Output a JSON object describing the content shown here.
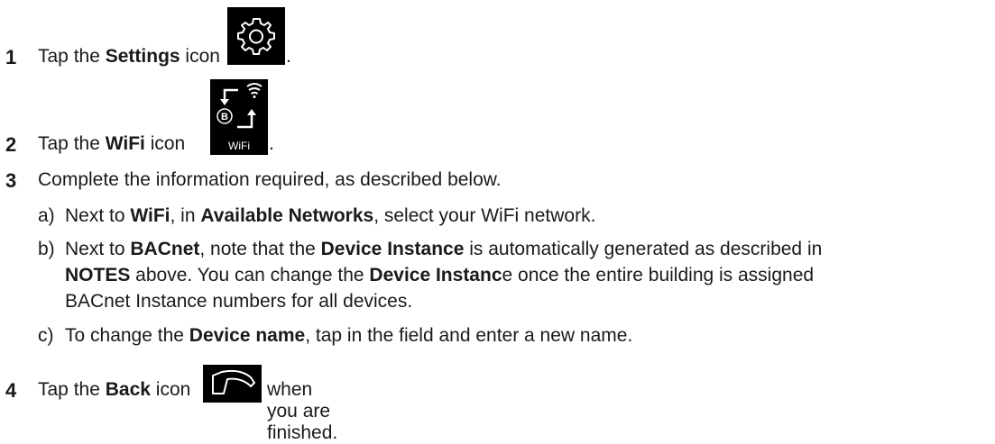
{
  "steps": [
    {
      "number": "1",
      "pre": "Tap the ",
      "bold": "Settings",
      "post": " icon",
      "trail": ".",
      "icon": "gear-icon"
    },
    {
      "number": "2",
      "pre": "Tap the ",
      "bold": "WiFi",
      "post": " icon",
      "trail": ".",
      "icon": "wifi-bacnet-icon",
      "icon_label": "WiFi"
    },
    {
      "number": "3",
      "text": "Complete the information required, as described below."
    },
    {
      "number": "4",
      "pre": "Tap the ",
      "bold": "Back",
      "post": " icon",
      "trail": " when you are finished.",
      "icon": "back-icon"
    }
  ],
  "substeps": {
    "a": {
      "letter": "a)",
      "t1": "Next to ",
      "b1": "WiFi",
      "t2": ", in ",
      "b2": "Available Networks",
      "t3": ", select your WiFi network."
    },
    "b": {
      "letter": "b)",
      "l1_t1": "Next to ",
      "l1_b1": "BACnet",
      "l1_t2": ", note that the ",
      "l1_b2": "Device Instance",
      "l1_t3": " is automatically generated as described in",
      "l2_b1": "NOTES",
      "l2_t1": " above. You can change the ",
      "l2_b2": "Device Instanc",
      "l2_t2": "e once the entire building is assigned",
      "l3": "BACnet Instance numbers for all devices."
    },
    "c": {
      "letter": "c)",
      "t1": "To change the ",
      "b1": "Device name",
      "t2": ", tap in the field and enter a new name."
    }
  },
  "colors": {
    "text": "#1a1a1a",
    "icon_bg": "#000000",
    "icon_fg": "#ffffff"
  }
}
